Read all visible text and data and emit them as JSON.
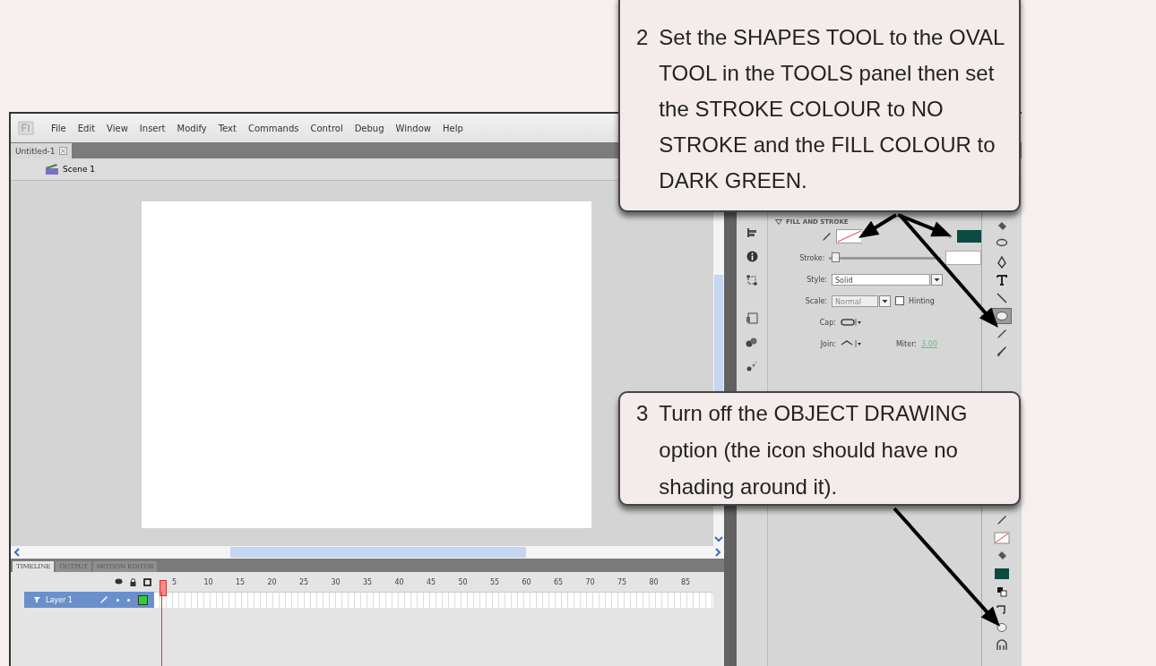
{
  "menu": [
    "File",
    "Edit",
    "View",
    "Insert",
    "Modify",
    "Text",
    "Commands",
    "Control",
    "Debug",
    "Window",
    "Help"
  ],
  "document_tab": {
    "label": "Untitled-1"
  },
  "scene": "Scene 1",
  "timeline": {
    "tabs": [
      {
        "label": "TIMELINE",
        "selected": true
      },
      {
        "label": "OUTPUT",
        "selected": false
      },
      {
        "label": "MOTION EDITOR",
        "selected": false
      }
    ],
    "frame_numbers": [
      "5",
      "10",
      "15",
      "20",
      "25",
      "30",
      "35",
      "40",
      "45",
      "50",
      "55",
      "60",
      "65",
      "70",
      "75",
      "80",
      "85"
    ],
    "layers": [
      {
        "name": "Layer 1",
        "selected": true
      }
    ]
  },
  "properties": {
    "section": "FILL AND STROKE",
    "rows": [
      {
        "label": "Stroke:",
        "kind": "slider",
        "level": 0.02
      },
      {
        "label": "Style:",
        "kind": "dropdown",
        "value": "Solid"
      },
      {
        "label": "Scale:",
        "kind": "scale",
        "value": "Normal",
        "checkbox": {
          "label": "Hinting",
          "checked": false
        }
      },
      {
        "label": "Cap:",
        "kind": "cap"
      },
      {
        "label": "Join:",
        "kind": "join",
        "extra_label": "Miter:",
        "extra_value": "3.00"
      }
    ]
  },
  "tools_top": [
    {
      "kind": "bucket",
      "selected": false
    },
    {
      "kind": "lasso",
      "selected": false
    },
    {
      "kind": "pen",
      "selected": false
    },
    {
      "kind": "text",
      "selected": false
    },
    {
      "kind": "line",
      "selected": false
    },
    {
      "kind": "oval",
      "selected": true
    },
    {
      "kind": "pencil",
      "selected": false
    },
    {
      "kind": "brush",
      "selected": false
    }
  ],
  "tools_bottom": [
    {
      "kind": "pencil",
      "selected": false
    },
    {
      "kind": "stroke-swatch",
      "selected": false
    },
    {
      "kind": "bucket",
      "selected": false
    },
    {
      "kind": "fill-swatch",
      "selected": false
    },
    {
      "kind": "default-colors",
      "selected": false
    },
    {
      "kind": "swap",
      "selected": false
    },
    {
      "kind": "object-drawing",
      "selected": false
    },
    {
      "kind": "snap",
      "selected": false
    }
  ],
  "callouts": [
    {
      "number": "2",
      "text": "Set the SHAPES TOOL to the OVAL TOOL in the TOOLS panel then set the STROKE COLOUR to NO STROKE and the FILL COLOUR to DARK GREEN."
    },
    {
      "number": "3",
      "text": "Turn off the OBJECT DRAWING option (the icon should have no shading around it)."
    }
  ]
}
